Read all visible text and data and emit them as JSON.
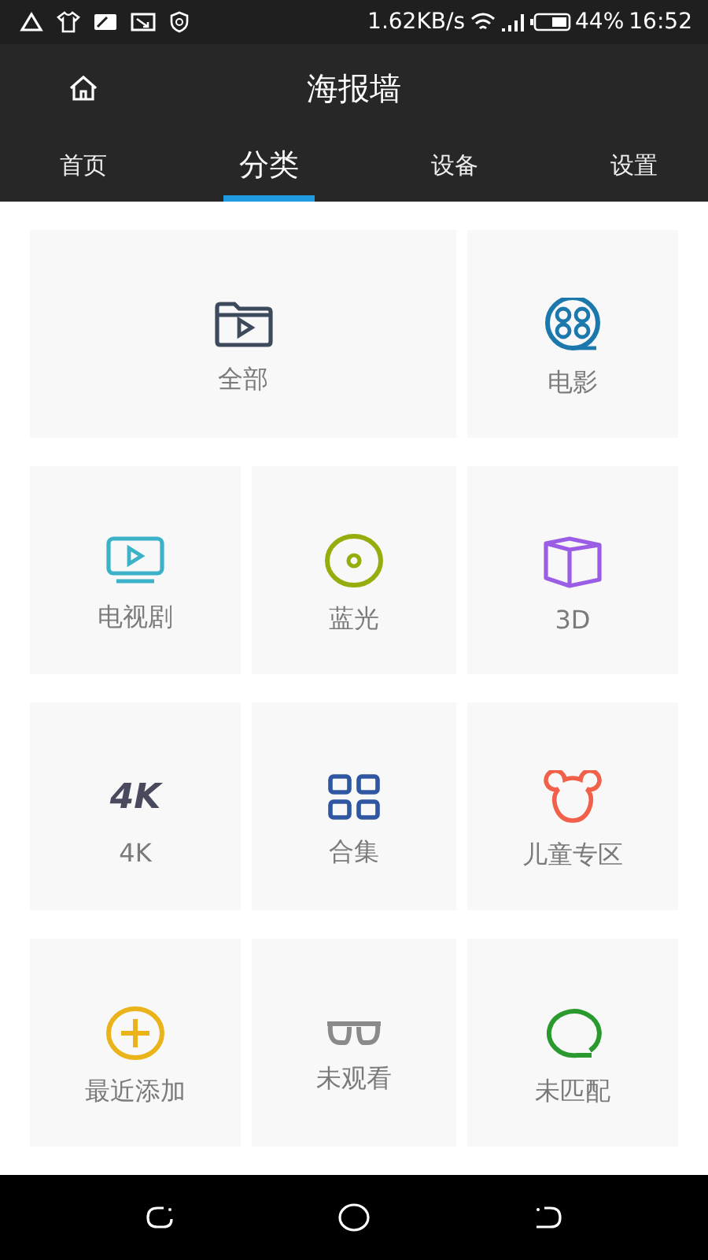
{
  "status_bar": {
    "speed": "1.62KB/s",
    "battery": "44%",
    "time": "16:52"
  },
  "header": {
    "title": "海报墙"
  },
  "tabs": [
    {
      "label": "首页",
      "selected": false
    },
    {
      "label": "分类",
      "selected": true
    },
    {
      "label": "设备",
      "selected": false
    },
    {
      "label": "设置",
      "selected": false
    }
  ],
  "categories": [
    {
      "label": "全部",
      "kind": "folder",
      "color": "#3d4a5c",
      "wide": true
    },
    {
      "label": "电影",
      "kind": "reel",
      "color": "#1a78ad",
      "wide": false
    },
    {
      "label": "电视剧",
      "kind": "tv",
      "color": "#3bb2c8",
      "wide": false
    },
    {
      "label": "蓝光",
      "kind": "disc",
      "color": "#97ad0e",
      "wide": false
    },
    {
      "label": "3D",
      "kind": "cube",
      "color": "#9b5de5",
      "wide": false
    },
    {
      "label": "4K",
      "kind": "text",
      "icon_text": "4K",
      "color": "#4a4a5e",
      "wide": false
    },
    {
      "label": "合集",
      "kind": "grid",
      "color": "#2f56a0",
      "wide": false
    },
    {
      "label": "儿童专区",
      "kind": "mouse",
      "color": "#f0604a",
      "wide": false
    },
    {
      "label": "最近添加",
      "kind": "plus",
      "color": "#e9b319",
      "wide": false
    },
    {
      "label": "未观看",
      "kind": "glasses",
      "color": "#8a8a8a",
      "wide": false
    },
    {
      "label": "未匹配",
      "kind": "bubble",
      "color": "#2a9a2e",
      "wide": false
    }
  ]
}
